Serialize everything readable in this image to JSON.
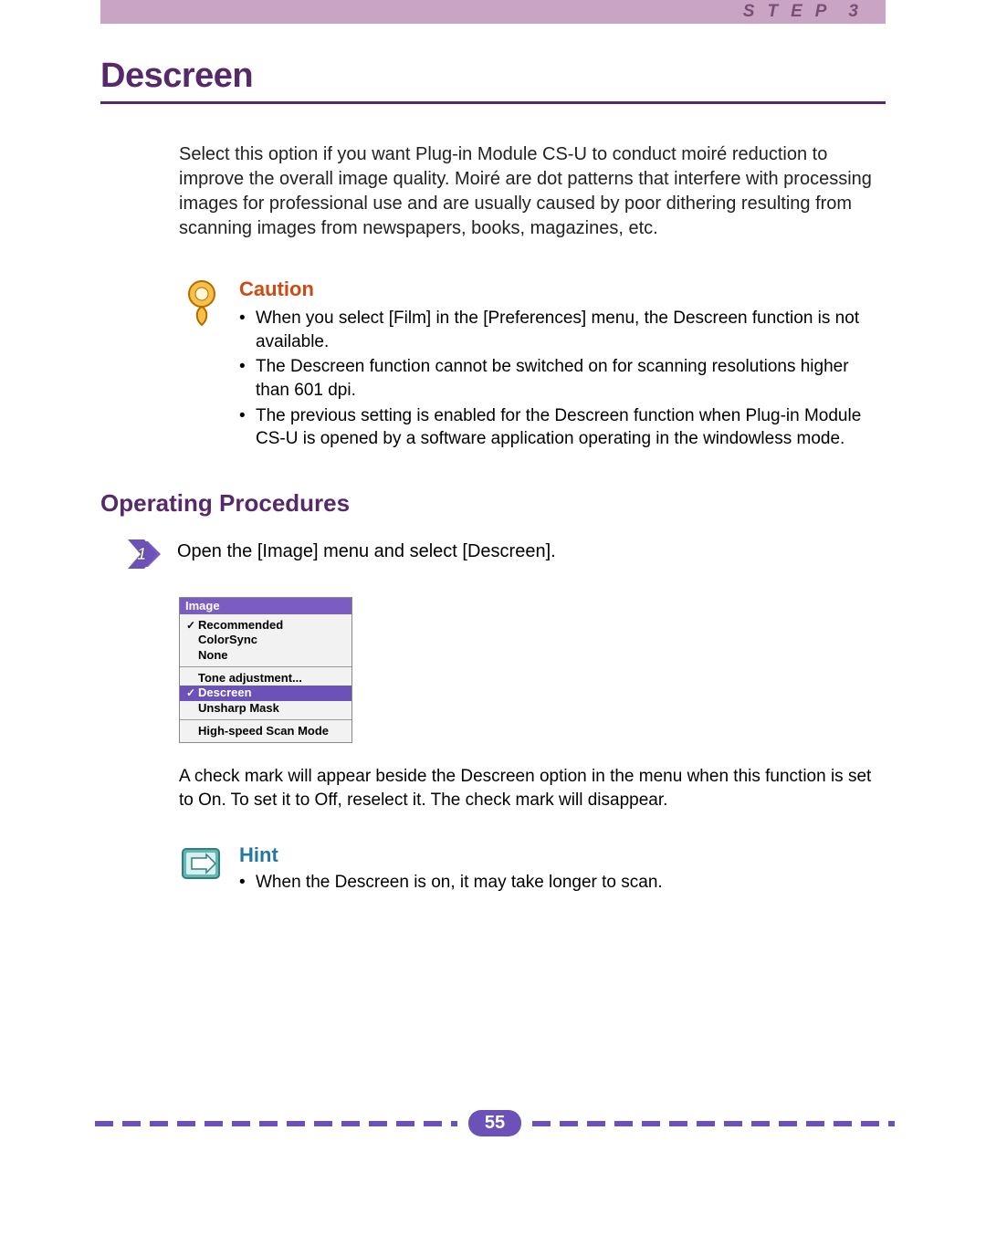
{
  "header": {
    "step_word": "STEP",
    "step_number": "3"
  },
  "title": "Descreen",
  "intro": "Select this option if you want Plug-in Module CS-U to conduct moiré reduction to improve the overall image quality. Moiré are dot patterns that interfere with processing images for professional use and are usually caused by poor dithering resulting from scanning images from newspapers, books, magazines, etc.",
  "caution": {
    "heading": "Caution",
    "items": [
      "When you select [Film] in the [Preferences] menu, the Descreen function is not available.",
      "The Descreen function cannot be switched on for scanning resolutions higher than 601 dpi.",
      "The previous setting is enabled for the Descreen function when Plug-in Module CS-U is opened by a software application operating in the windowless mode."
    ]
  },
  "section_heading": "Operating Procedures",
  "step1": {
    "number": "1",
    "text": "Open the [Image] menu and select [Descreen]."
  },
  "menu": {
    "title": "Image",
    "items": [
      {
        "label": "Recommended",
        "checked": true,
        "selected": false
      },
      {
        "label": "ColorSync",
        "checked": false,
        "selected": false
      },
      {
        "label": "None",
        "checked": false,
        "selected": false
      },
      {
        "label": "Tone adjustment...",
        "checked": false,
        "selected": false,
        "sep": true
      },
      {
        "label": "Descreen",
        "checked": true,
        "selected": true
      },
      {
        "label": "Unsharp Mask",
        "checked": false,
        "selected": false
      },
      {
        "label": "High-speed Scan Mode",
        "checked": false,
        "selected": false,
        "sep": true
      }
    ]
  },
  "follow_para": "A check mark will appear beside the Descreen option in the menu when this function is set to On. To set it to Off, reselect it. The check mark will disappear.",
  "hint": {
    "heading": "Hint",
    "items": [
      "When the Descreen is on, it may take longer to scan."
    ]
  },
  "page_number": "55"
}
